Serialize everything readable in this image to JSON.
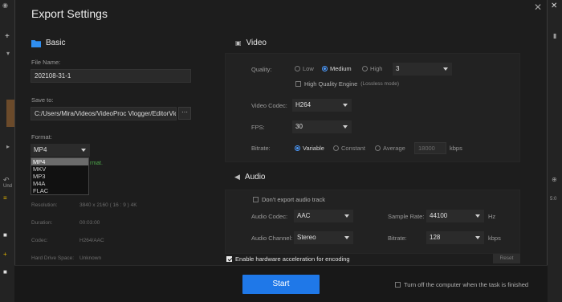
{
  "dialog": {
    "title": "Export Settings"
  },
  "basic": {
    "heading": "Basic",
    "file_name_label": "File Name:",
    "file_name_value": "202108-31-1",
    "save_to_label": "Save to:",
    "save_to_value": "C:/Users/Mira/Videos/VideoProc Vlogger/EditorVideo",
    "browse_label": "···",
    "format_label": "Format:",
    "format_value": "MP4",
    "format_options": [
      "MP4",
      "MKV",
      "MP3",
      "M4A",
      "FLAC"
    ],
    "partial_text": "rmat.",
    "info": [
      {
        "label": "Resolution:",
        "value": "3840 x 2160   ( 16 : 9 )   4K"
      },
      {
        "label": "Duration:",
        "value": "00:03:00"
      },
      {
        "label": "Codec:",
        "value": "H264/AAC"
      },
      {
        "label": "Hard Drive Space:",
        "value": "Unknown"
      }
    ]
  },
  "video": {
    "heading": "Video",
    "quality_label": "Quality:",
    "quality_options": [
      "Low",
      "Medium",
      "High"
    ],
    "quality_level_value": "3",
    "hq_engine_label": "High Quality Engine",
    "hq_engine_note": "(Lossless mode)",
    "codec_label": "Video Codec:",
    "codec_value": "H264",
    "fps_label": "FPS:",
    "fps_value": "30",
    "bitrate_label": "Bitrate:",
    "bitrate_options": [
      "Variable",
      "Constant",
      "Average"
    ],
    "bitrate_value": "18000",
    "bitrate_unit": "kbps"
  },
  "audio": {
    "heading": "Audio",
    "dont_export_label": "Don't export audio track",
    "codec_label": "Audio Codec:",
    "codec_value": "AAC",
    "sample_rate_label": "Sample Rate:",
    "sample_rate_value": "44100",
    "sample_rate_unit": "Hz",
    "channel_label": "Audio Channel:",
    "channel_value": "Stereo",
    "bitrate_label": "Bitrate:",
    "bitrate_value": "128",
    "bitrate_unit": "kbps"
  },
  "hw_accel_label": "Enable hardware acceleration for encoding",
  "reset_label": "Reset",
  "start_label": "Start",
  "turn_off_label": "Turn off the computer when the task is finished",
  "background": {
    "undo_label": "Und",
    "zoom_label": "5:0"
  },
  "colors": {
    "accent": "#1f78e8",
    "radio_active": "#4c9bff",
    "folder_icon": "#2f8ef0"
  }
}
